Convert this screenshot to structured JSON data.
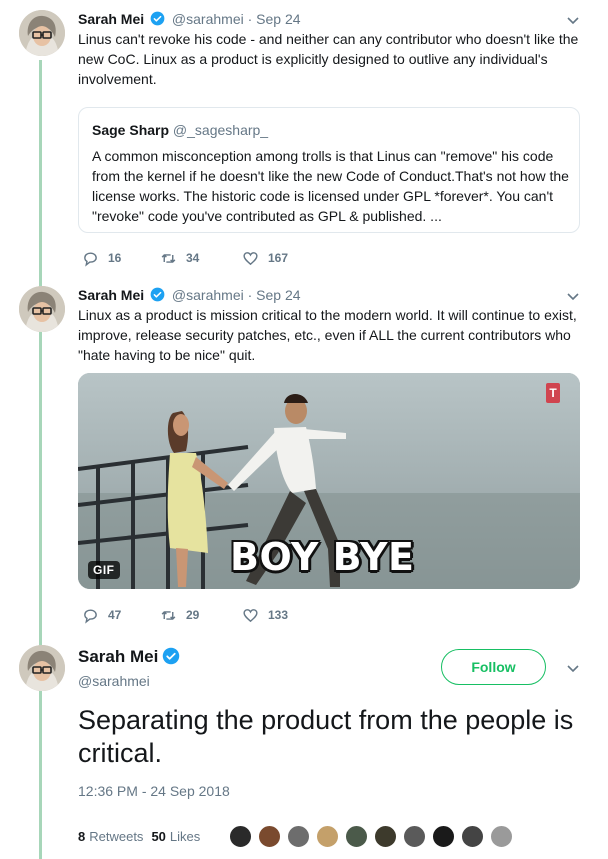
{
  "tweets": [
    {
      "name": "Sarah Mei",
      "handle": "@sarahmei",
      "separator": "·",
      "date": "Sep 24",
      "text": "Linus can't revoke his code - and neither can any contributor who doesn't like the new CoC. Linux as a product is explicitly designed to outlive any individual's involvement.",
      "quote": {
        "name": "Sage Sharp",
        "handle": "@_sagesharp_",
        "text": "A common misconception among trolls is that Linus can \"remove\" his code from the kernel if he doesn't like the new Code of Conduct.That's not how the license works. The historic code is licensed under GPL *forever*. You can't \"revoke\" code you've contributed as GPL & published. ..."
      },
      "replies": "16",
      "retweets": "34",
      "likes": "167"
    },
    {
      "name": "Sarah Mei",
      "handle": "@sarahmei",
      "separator": "·",
      "date": "Sep 24",
      "text": "Linux as a product is mission critical to the modern world. It will continue to exist, improve, release security patches, etc., even if ALL the current contributors who \"hate having to be nice\" quit.",
      "media": {
        "badge": "GIF",
        "caption": "BOY BYE",
        "watermark": "T"
      },
      "replies": "47",
      "retweets": "29",
      "likes": "133"
    }
  ],
  "main_tweet": {
    "name": "Sarah Mei",
    "handle": "@sarahmei",
    "follow_label": "Follow",
    "text": "Separating the product from the people is critical.",
    "timestamp": "12:36 PM - 24 Sep 2018",
    "retweet_count": "8",
    "retweet_label": "Retweets",
    "like_count": "50",
    "like_label": "Likes",
    "liker_count": 10
  },
  "colors": {
    "thread_line": "#a7d6b9",
    "follow_green": "#17bf63",
    "verified_blue": "#1da1f2",
    "muted": "#657786"
  },
  "icons": {
    "reply": "reply-icon",
    "retweet": "retweet-icon",
    "like": "heart-icon",
    "verified": "verified-badge-icon",
    "menu": "chevron-down-icon"
  }
}
